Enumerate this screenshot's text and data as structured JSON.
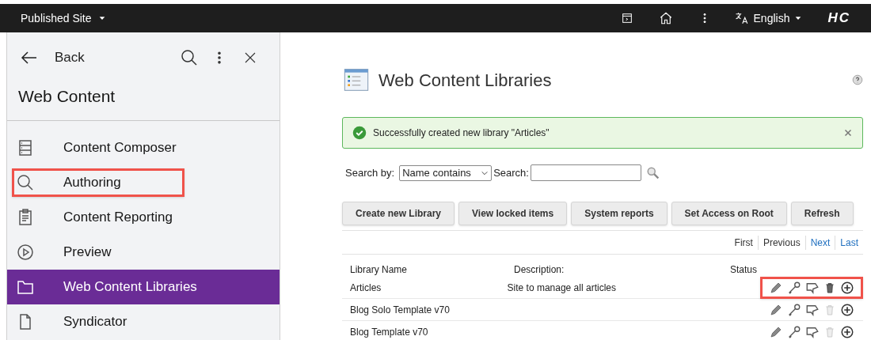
{
  "top_bar": {
    "site_menu": "Published Site",
    "language": "English",
    "logo": "HC"
  },
  "sidebar": {
    "back": "Back",
    "title": "Web Content",
    "items": [
      {
        "label": "Content Composer",
        "kind": "stack",
        "selected": false,
        "highlighted": false
      },
      {
        "label": "Authoring",
        "kind": "search",
        "selected": false,
        "highlighted": true
      },
      {
        "label": "Content Reporting",
        "kind": "clipboard",
        "selected": false,
        "highlighted": false
      },
      {
        "label": "Preview",
        "kind": "play",
        "selected": false,
        "highlighted": false
      },
      {
        "label": "Web Content Libraries",
        "kind": "folder",
        "selected": true,
        "highlighted": false
      },
      {
        "label": "Syndicator",
        "kind": "document",
        "selected": false,
        "highlighted": false
      }
    ]
  },
  "main": {
    "title": "Web Content Libraries",
    "alert": "Successfully created new library \"Articles\"",
    "search": {
      "by_label": "Search by:",
      "by_value": "Name contains",
      "label": "Search:"
    },
    "buttons": [
      "Create new Library",
      "View locked items",
      "System reports",
      "Set Access on Root",
      "Refresh"
    ],
    "pagination": [
      {
        "label": "First",
        "enabled": false
      },
      {
        "label": "Previous",
        "enabled": false
      },
      {
        "label": "Next",
        "enabled": true
      },
      {
        "label": "Last",
        "enabled": true
      }
    ],
    "table": {
      "columns": [
        "Library Name",
        "Description:",
        "Status"
      ],
      "rows": [
        {
          "name": "Articles",
          "description": "Site to manage all articles",
          "highlighted": true,
          "delete_disabled": false
        },
        {
          "name": "Blog Solo Template v70",
          "description": "",
          "highlighted": false,
          "delete_disabled": true
        },
        {
          "name": "Blog Template v70",
          "description": "",
          "highlighted": false,
          "delete_disabled": true
        }
      ]
    }
  }
}
